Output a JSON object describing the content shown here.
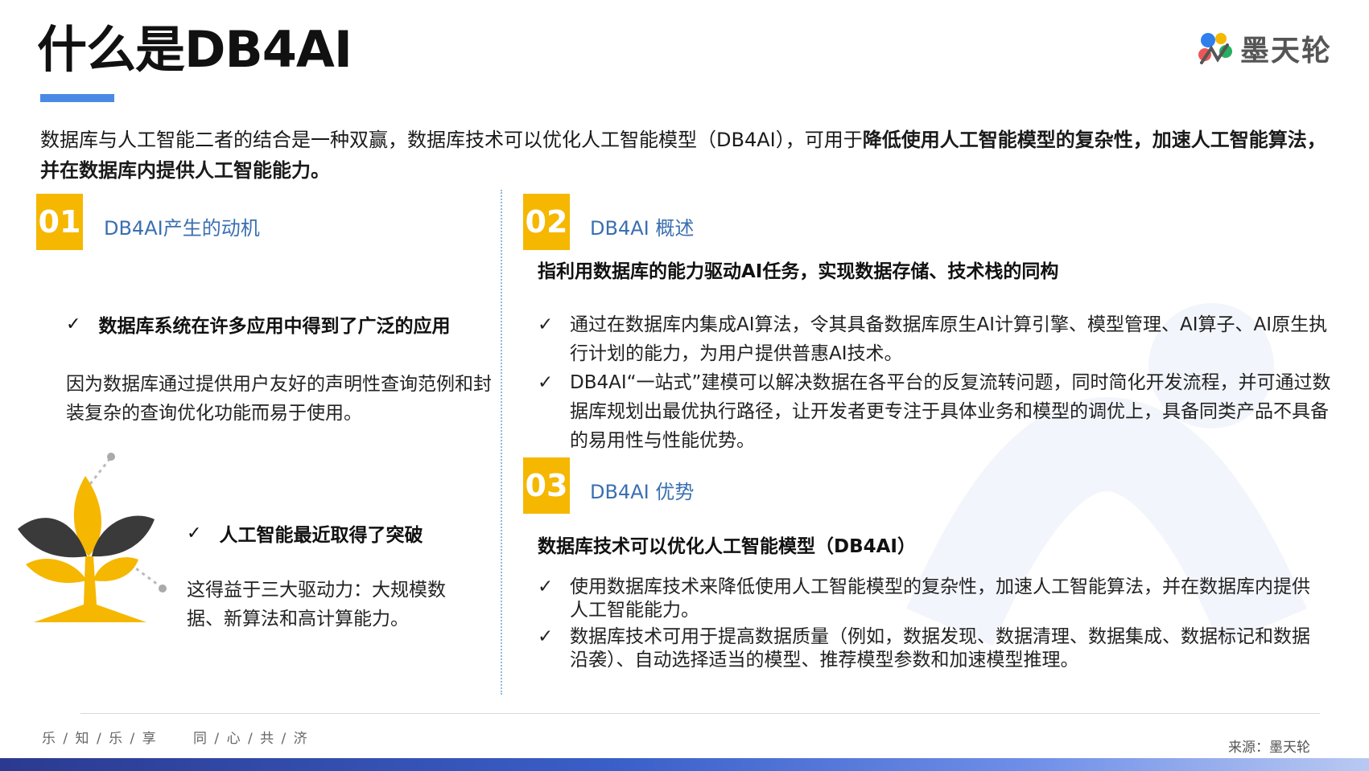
{
  "slide": {
    "title": "什么是DB4AI",
    "logo_text": "墨天轮",
    "intro_normal": "数据库与人工智能二者的结合是一种双赢，数据库技术可以优化人工智能模型（DB4AI），可用于",
    "intro_bold": "降低使用人工智能模型的复杂性，加速人工智能算法，并在数据库内提供人工智能能力。"
  },
  "sections": {
    "s1": {
      "num": "01",
      "title": "DB4AI产生的动机",
      "point1": "数据库系统在许多应用中得到了广泛的应用",
      "text1": "因为数据库通过提供用户友好的声明性查询范例和封装复杂的查询优化功能而易于使用。",
      "point2": "人工智能最近取得了突破",
      "text2": "这得益于三大驱动力：大规模数据、新算法和高计算能力。"
    },
    "s2": {
      "num": "02",
      "title": "DB4AI 概述",
      "subtitle": "指利用数据库的能力驱动AI任务，实现数据存储、技术栈的同构",
      "items": [
        "通过在数据库内集成AI算法，令其具备数据库原生AI计算引擎、模型管理、AI算子、AI原生执行计划的能力，为用户提供普惠AI技术。",
        "DB4AI“一站式”建模可以解决数据在各平台的反复流转问题，同时简化开发流程，并可通过数据库规划出最优执行路径，让开发者更专注于具体业务和模型的调优上，具备同类产品不具备的易用性与性能优势。"
      ]
    },
    "s3": {
      "num": "03",
      "title": "DB4AI 优势",
      "subtitle": "数据库技术可以优化人工智能模型（DB4AI）",
      "items": [
        "使用数据库技术来降低使用人工智能模型的复杂性，加速人工智能算法，并在数据库内提供人工智能能力。",
        "数据库技术可用于提高数据质量（例如，数据发现、数据清理、数据集成、数据标记和数据沿袭）、自动选择适当的模型、推荐模型参数和加速模型推理。"
      ]
    }
  },
  "footer": {
    "slogan": "乐 / 知 / 乐 / 享      同 / 心 / 共 / 济",
    "source": "来源：墨天轮"
  },
  "colors": {
    "accent_yellow": "#f5b700",
    "section_blue": "#3a6fb0",
    "title_bar_blue": "#4a8ae6",
    "divider_blue": "#8fb8e0"
  },
  "icons": {
    "check": "✓",
    "logo": "motianlun-logo-icon",
    "plant": "plant-tree-icon"
  }
}
